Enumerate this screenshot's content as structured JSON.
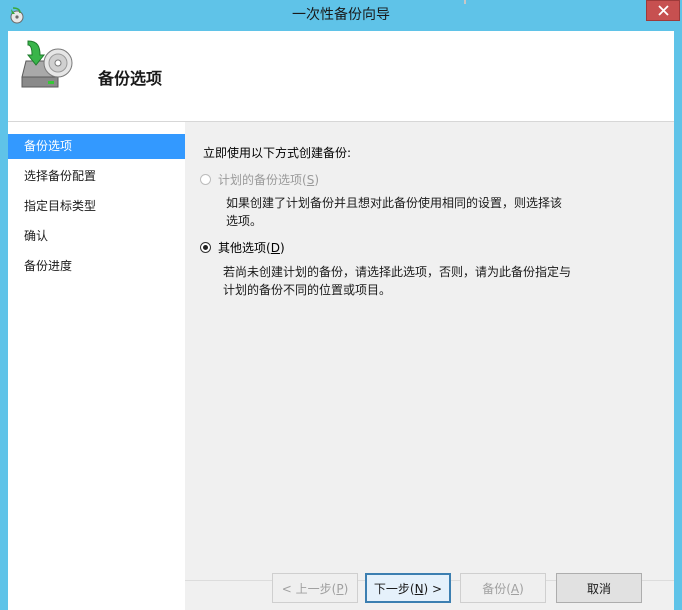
{
  "window": {
    "title": "一次性备份向导",
    "icons": {
      "app": "backup-app-icon",
      "close": "close-icon"
    }
  },
  "header": {
    "title": "备份选项",
    "icon": "backup-wizard-icon"
  },
  "nav": {
    "items": [
      {
        "label": "备份选项",
        "active": true
      },
      {
        "label": "选择备份配置",
        "active": false
      },
      {
        "label": "指定目标类型",
        "active": false
      },
      {
        "label": "确认",
        "active": false
      },
      {
        "label": "备份进度",
        "active": false
      }
    ]
  },
  "main": {
    "prompt": "立即使用以下方式创建备份:",
    "options": [
      {
        "label": "计划的备份选项",
        "mnemonic": "S",
        "enabled": false,
        "selected": false,
        "description": "如果创建了计划备份并且想对此备份使用相同的设置，则选择该选项。"
      },
      {
        "label": "其他选项",
        "mnemonic": "D",
        "enabled": true,
        "selected": true,
        "description": "若尚未创建计划的备份，请选择此选项，否则，请为此备份指定与计划的备份不同的位置或项目。"
      }
    ]
  },
  "buttons": {
    "prev": {
      "label": "< 上一步(",
      "mnemonic": "P",
      "suffix": ")",
      "enabled": false
    },
    "next": {
      "label": "下一步(",
      "mnemonic": "N",
      "suffix": ") >",
      "enabled": true
    },
    "backup": {
      "label": "备份(",
      "mnemonic": "A",
      "suffix": ")",
      "enabled": false
    },
    "cancel": {
      "label": "取消",
      "enabled": true
    }
  },
  "colors": {
    "titlebar": "#5fc3e8",
    "nav_active": "#3399ff",
    "close": "#c75050"
  }
}
